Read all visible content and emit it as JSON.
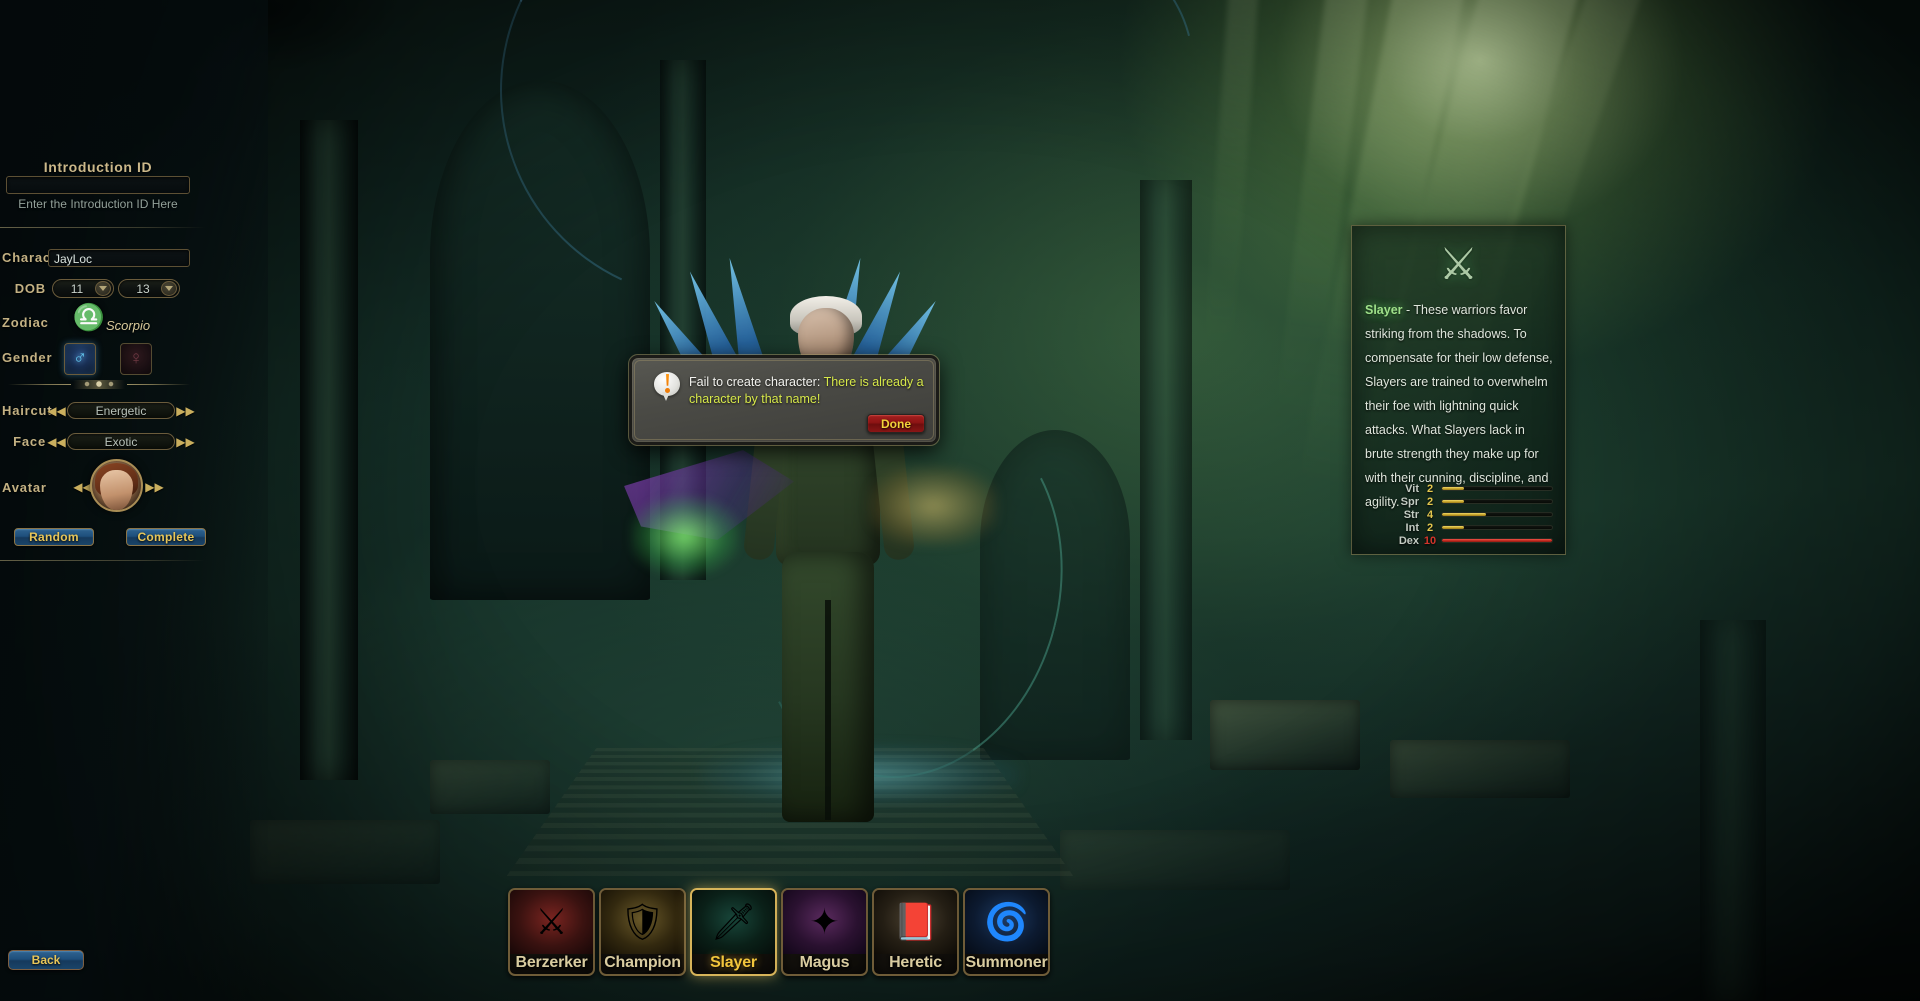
{
  "intro": {
    "title": "Introduction ID",
    "value": "",
    "placeholder": "",
    "hint": "Enter the Introduction ID Here"
  },
  "character_form": {
    "name_label": "Character",
    "name_value": "JayLoc",
    "dob_label": "DOB",
    "dob_month": "11",
    "dob_day": "13",
    "zodiac_label": "Zodiac",
    "zodiac_value": "Scorpio",
    "zodiac_icon": "scorpion-icon",
    "gender_label": "Gender",
    "gender_male_icon": "male-symbol-icon",
    "gender_female_icon": "female-symbol-icon",
    "haircut_label": "Haircut",
    "haircut_value": "Energetic",
    "face_label": "Face",
    "face_value": "Exotic",
    "avatar_label": "Avatar",
    "random_label": "Random",
    "complete_label": "Complete"
  },
  "nav": {
    "back_label": "Back"
  },
  "class_info": {
    "emblem_icon": "slayer-emblem-icon",
    "name": "Slayer",
    "description": " - These warriors favor striking from the shadows. To compensate for their low defense, Slayers are trained to overwhelm their foe with lightning quick attacks. What Slayers lack in brute strength they make up for with their cunning, discipline, and agility."
  },
  "stats": {
    "max": 10,
    "rows": [
      {
        "name": "Vit",
        "value": 2,
        "maxed": false
      },
      {
        "name": "Spr",
        "value": 2,
        "maxed": false
      },
      {
        "name": "Str",
        "value": 4,
        "maxed": false
      },
      {
        "name": "Int",
        "value": 2,
        "maxed": false
      },
      {
        "name": "Dex",
        "value": 10,
        "maxed": true
      }
    ]
  },
  "classes": [
    {
      "name": "Berzerker",
      "art": "art-berzerker",
      "glyph": "⚔",
      "selected": false
    },
    {
      "name": "Champion",
      "art": "art-champion",
      "glyph": "🛡",
      "selected": false
    },
    {
      "name": "Slayer",
      "art": "art-slayer",
      "glyph": "🗡",
      "selected": true
    },
    {
      "name": "Magus",
      "art": "art-magus",
      "glyph": "✦",
      "selected": false
    },
    {
      "name": "Heretic",
      "art": "art-heretic",
      "glyph": "📕",
      "selected": false
    },
    {
      "name": "Summoner",
      "art": "art-summoner",
      "glyph": "🌀",
      "selected": false
    }
  ],
  "dialog": {
    "icon": "exclamation-icon",
    "message_prefix": "Fail to create character: ",
    "message_highlight": "There is already a character by that name!",
    "done_label": "Done"
  },
  "colors": {
    "gold": "#c3b183",
    "highlight_yellow": "#d7e84a",
    "stat_yellow": "#e3c64e",
    "stat_red": "#d3352b",
    "class_green": "#9fe08a",
    "button_blue": "#1e4f7c",
    "done_red": "#8d1414"
  }
}
